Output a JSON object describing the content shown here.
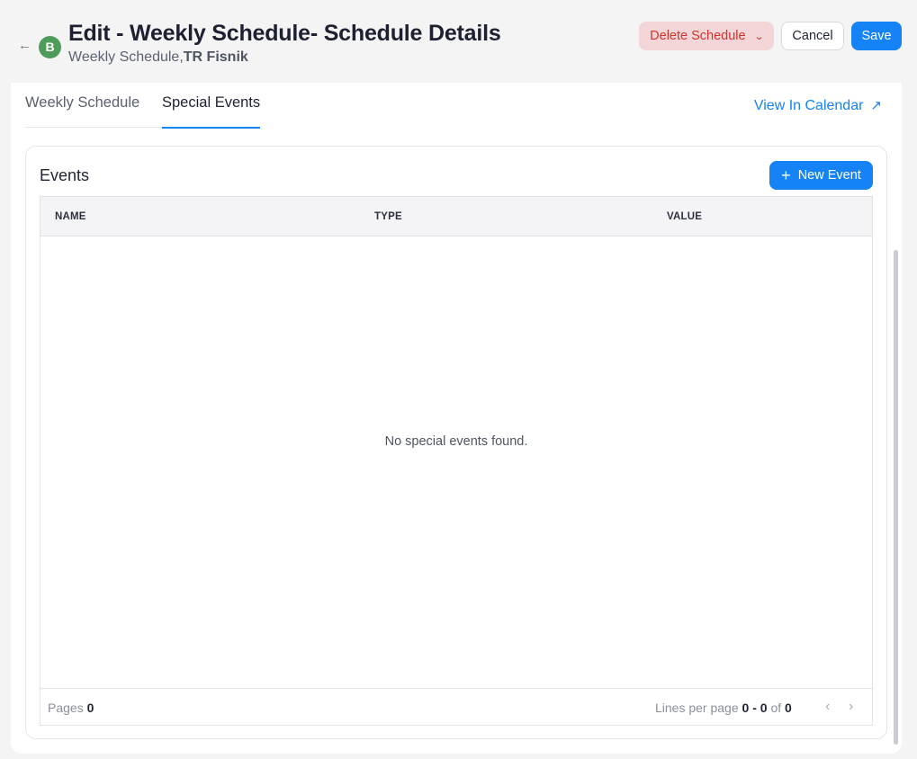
{
  "header": {
    "avatar_letter": "B",
    "title": "Edit - Weekly Schedule- Schedule Details",
    "subtitle_prefix": "Weekly Schedule,",
    "subtitle_bold": "TR Fisnik",
    "delete_label": "Delete Schedule",
    "cancel_label": "Cancel",
    "save_label": "Save"
  },
  "tabs": [
    {
      "label": "Weekly Schedule",
      "active": false
    },
    {
      "label": "Special Events",
      "active": true
    }
  ],
  "view_calendar_label": "View In Calendar",
  "events": {
    "title": "Events",
    "new_event_label": "New Event",
    "columns": [
      "NAME",
      "TYPE",
      "VALUE"
    ],
    "empty_message": "No special events found.",
    "footer": {
      "pages_label": "Pages",
      "pages_value": "0",
      "lines_label": "Lines per page",
      "range": "0 - 0",
      "of_label": "of",
      "total": "0"
    }
  },
  "icons": {
    "back": "arrow-left-icon",
    "delete_dropdown": "chevron-down-icon",
    "calendar_link": "arrow-up-right-icon",
    "new_event": "plus-icon",
    "prev": "chevron-left-icon",
    "next": "chevron-right-icon"
  },
  "colors": {
    "primary": "#1583f5",
    "danger_bg": "#f5d6d8",
    "danger_text": "#d0342c",
    "avatar": "#4f9c5a"
  }
}
